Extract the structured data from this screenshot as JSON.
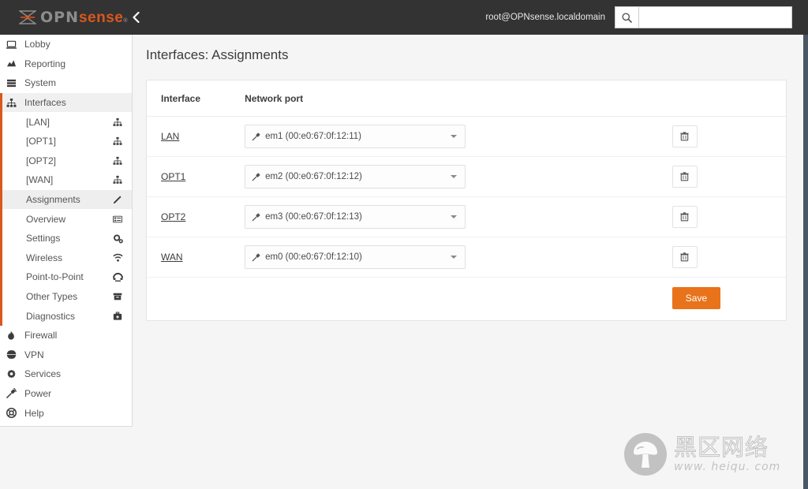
{
  "header": {
    "brand_opn": "OPN",
    "brand_sense": "sense",
    "brand_reg": "®",
    "collapse_icon": "chevron-left-icon",
    "user": "root@OPNsense.localdomain",
    "search_icon": "search-icon",
    "search_value": "",
    "search_placeholder": ""
  },
  "sidebar": {
    "items": [
      {
        "label": "Lobby",
        "icon": "laptop-icon",
        "active": false
      },
      {
        "label": "Reporting",
        "icon": "chart-area-icon",
        "active": false
      },
      {
        "label": "System",
        "icon": "server-icon",
        "active": false
      },
      {
        "label": "Interfaces",
        "icon": "sitemap-icon",
        "active": true
      }
    ],
    "sub_items": [
      {
        "label": "[LAN]",
        "icon": "sitemap-icon",
        "selected": false
      },
      {
        "label": "[OPT1]",
        "icon": "sitemap-icon",
        "selected": false
      },
      {
        "label": "[OPT2]",
        "icon": "sitemap-icon",
        "selected": false
      },
      {
        "label": "[WAN]",
        "icon": "sitemap-icon",
        "selected": false
      },
      {
        "label": "Assignments",
        "icon": "pencil-icon",
        "selected": true
      },
      {
        "label": "Overview",
        "icon": "list-alt-icon",
        "selected": false
      },
      {
        "label": "Settings",
        "icon": "cogs-icon",
        "selected": false
      },
      {
        "label": "Wireless",
        "icon": "wifi-icon",
        "selected": false
      },
      {
        "label": "Point-to-Point",
        "icon": "phone-icon",
        "selected": false
      },
      {
        "label": "Other Types",
        "icon": "archive-icon",
        "selected": false
      },
      {
        "label": "Diagnostics",
        "icon": "briefcase-icon",
        "selected": false
      }
    ],
    "bottom_items": [
      {
        "label": "Firewall",
        "icon": "fire-icon"
      },
      {
        "label": "VPN",
        "icon": "globe-icon"
      },
      {
        "label": "Services",
        "icon": "gear-icon"
      },
      {
        "label": "Power",
        "icon": "plug-icon"
      },
      {
        "label": "Help",
        "icon": "life-ring-icon"
      }
    ]
  },
  "main": {
    "page_title": "Interfaces: Assignments",
    "table": {
      "headers": [
        "Interface",
        "Network port",
        ""
      ],
      "rows": [
        {
          "interface": "LAN",
          "port": "em1 (00:e0:67:0f:12:11)",
          "port_icon": "plug-icon",
          "delete_icon": "trash-icon"
        },
        {
          "interface": "OPT1",
          "port": "em2 (00:e0:67:0f:12:12)",
          "port_icon": "plug-icon",
          "delete_icon": "trash-icon"
        },
        {
          "interface": "OPT2",
          "port": "em3 (00:e0:67:0f:12:13)",
          "port_icon": "plug-icon",
          "delete_icon": "trash-icon"
        },
        {
          "interface": "WAN",
          "port": "em0 (00:e0:67:0f:12:10)",
          "port_icon": "plug-icon",
          "delete_icon": "trash-icon"
        }
      ]
    },
    "save_label": "Save"
  },
  "watermark": {
    "cn_text": "黑区网络",
    "url_text": "www. heiqu. com",
    "logo_icon": "mushroom-icon"
  },
  "colors": {
    "accent_orange": "#d9581e",
    "save_orange": "#e8731a",
    "header_dark": "#333333",
    "content_bg": "#f5f5f5",
    "scrollbar": "#4a5663"
  }
}
